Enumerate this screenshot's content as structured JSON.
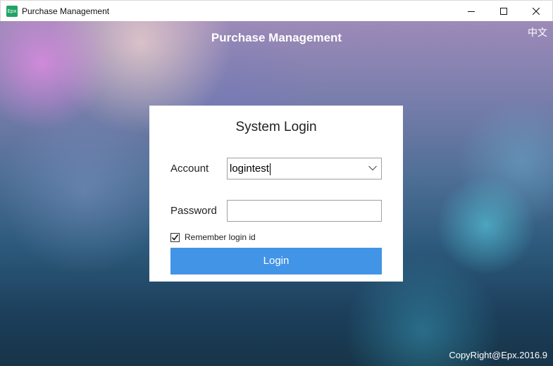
{
  "window": {
    "app_icon_text": "Epx",
    "title": "Purchase Management"
  },
  "header": {
    "title": "Purchase Management",
    "language_toggle": "中文"
  },
  "login": {
    "title": "System Login",
    "account_label": "Account",
    "account_value": "logintest",
    "password_label": "Password",
    "password_value": "",
    "remember_label": "Remember login id",
    "remember_checked": true,
    "login_button": "Login"
  },
  "footer": {
    "copyright": "CopyRight@Epx.2016.9"
  },
  "colors": {
    "login_button": "#4294e6",
    "app_icon": "#21a366"
  }
}
